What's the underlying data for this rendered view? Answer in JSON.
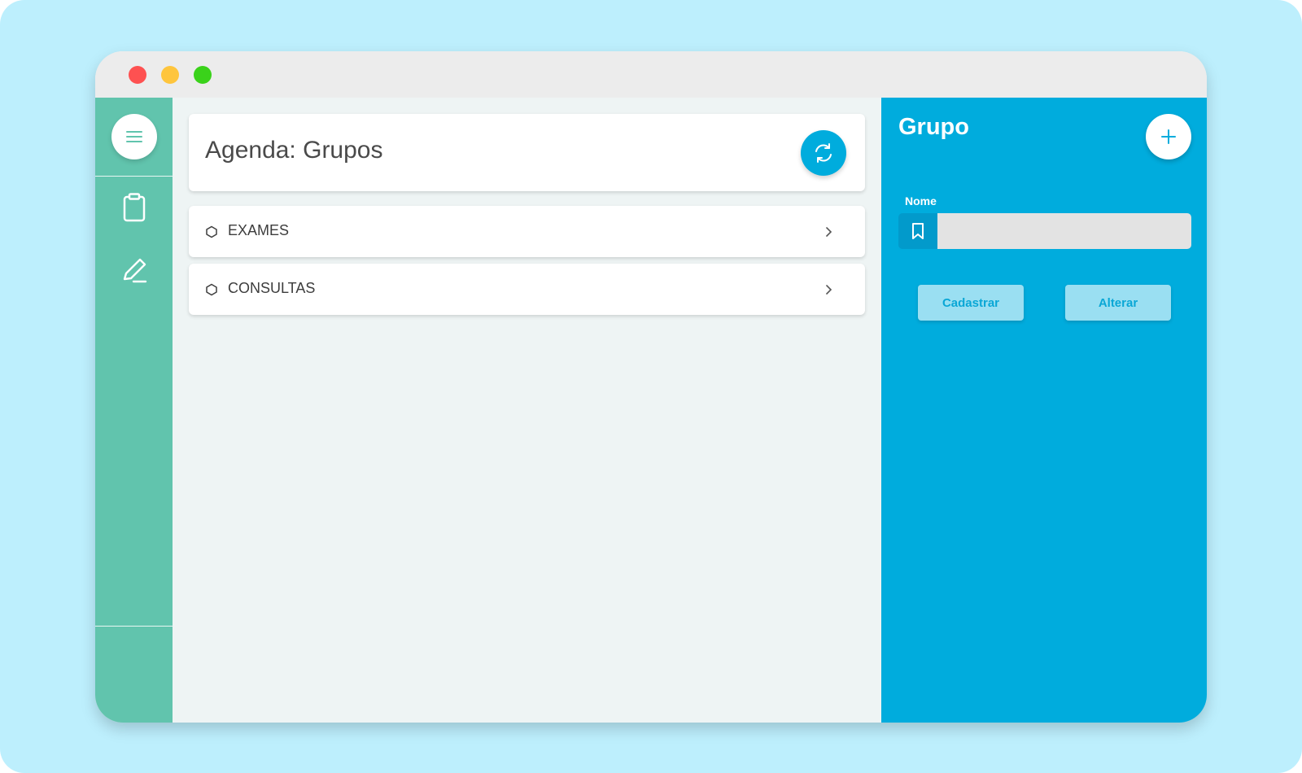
{
  "main": {
    "title": "Agenda: Grupos",
    "groups": [
      {
        "label": "EXAMES"
      },
      {
        "label": "CONSULTAS"
      }
    ]
  },
  "panel": {
    "title": "Grupo",
    "field_label": "Nome",
    "field_value": "",
    "field_placeholder": "",
    "buttons": {
      "cadastrar": "Cadastrar",
      "alterar": "Alterar"
    }
  },
  "icons": {
    "menu": "menu-icon",
    "clipboard": "clipboard-icon",
    "edit": "pencil-icon",
    "refresh": "refresh-icon",
    "add": "plus-icon",
    "bookmark": "bookmark-icon",
    "hexagon": "hexagon-icon",
    "chevron": "chevron-right-icon"
  },
  "colors": {
    "sidebar": "#61c4ad",
    "accent": "#00acdd",
    "page_bg": "#eef4f4",
    "backdrop": "#bdeffd",
    "titlebar": "#ececec",
    "close": "#fe5151",
    "minimize": "#fec53d",
    "maximize": "#3ad21a"
  }
}
